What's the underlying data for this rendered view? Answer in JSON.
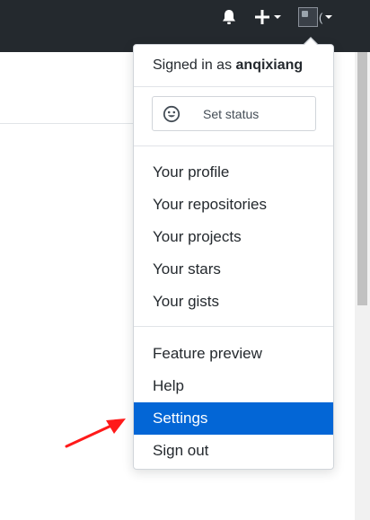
{
  "topbar": {
    "icons": [
      "bell-icon",
      "plus-icon",
      "caret-down-icon",
      "avatar-image-icon"
    ],
    "avatar_alt_fragment": "(",
    "background": "#24292e"
  },
  "dropdown": {
    "signed_in_prefix": "Signed in as ",
    "username": "anqixiang",
    "set_status_label": "Set status",
    "set_status_icon": "smiley-icon",
    "section_profile": [
      "Your profile",
      "Your repositories",
      "Your projects",
      "Your stars",
      "Your gists"
    ],
    "section_account": [
      "Feature preview",
      "Help",
      "Settings",
      "Sign out"
    ],
    "highlighted_item": "Settings",
    "highlight_color": "#0366d6"
  },
  "annotation": {
    "arrow_color": "#ff1a1a",
    "arrow_icon": "red-arrow-icon"
  }
}
